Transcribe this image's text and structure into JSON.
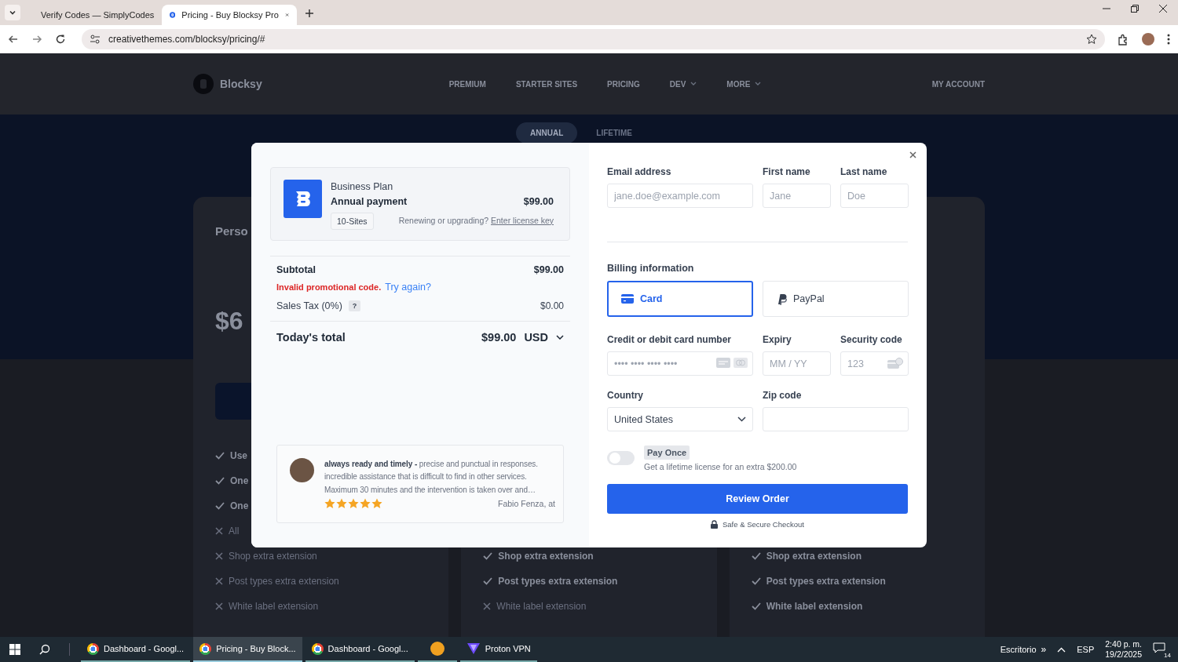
{
  "browser": {
    "tabs": [
      {
        "title": "Verify Codes — SimplyCodes",
        "kind": "verify",
        "selected": false
      },
      {
        "title": "Pricing - Buy Blocksy Pro",
        "kind": "blocksy",
        "selected": true
      }
    ],
    "url": "creativethemes.com/blocksy/pricing/#"
  },
  "site": {
    "logo": "Blocksy",
    "nav": [
      {
        "label": "PREMIUM",
        "dropdown": false
      },
      {
        "label": "STARTER SITES",
        "dropdown": false
      },
      {
        "label": "PRICING",
        "dropdown": false
      },
      {
        "label": "DEV",
        "dropdown": true
      },
      {
        "label": "MORE",
        "dropdown": true
      }
    ],
    "account": "MY ACCOUNT",
    "billing_toggle": [
      {
        "label": "ANNUAL",
        "selected": true
      },
      {
        "label": "LIFETIME",
        "selected": false
      }
    ],
    "plans": [
      {
        "name": "Perso",
        "price": "$6",
        "features": [
          {
            "label": "Use",
            "included": true
          },
          {
            "label": "One",
            "included": true
          },
          {
            "label": "One",
            "included": true
          },
          {
            "label": "All",
            "included": false
          },
          {
            "label": "Shop extra extension",
            "included": false
          },
          {
            "label": "Post types extra extension",
            "included": false
          },
          {
            "label": "White label extension",
            "included": false
          }
        ]
      },
      {
        "features": [
          {
            "label": "Shop extra extension",
            "included": true
          },
          {
            "label": "Post types extra extension",
            "included": true
          },
          {
            "label": "White label extension",
            "included": false
          }
        ]
      },
      {
        "features": [
          {
            "label": "Shop extra extension",
            "included": true
          },
          {
            "label": "Post types extra extension",
            "included": true
          },
          {
            "label": "White label extension",
            "included": true
          }
        ]
      }
    ]
  },
  "checkout": {
    "order": {
      "plan": "Business Plan",
      "billing": "Annual payment",
      "price": "$99.00",
      "sites": "10-Sites",
      "renew_prompt": "Renewing or upgrading?",
      "renew_link": "Enter license key"
    },
    "summary": {
      "subtotal_label": "Subtotal",
      "subtotal": "$99.00",
      "promo_error": "Invalid promotional code.",
      "promo_retry": "Try again?",
      "tax_label": "Sales Tax (0%)",
      "tax_help": "?",
      "tax": "$0.00",
      "total_label": "Today's total",
      "total": "$99.00",
      "currency": "USD"
    },
    "testimonial": {
      "text": "**always ready and timely -** precise and punctual in responses. incredible assistance that is difficult to find in other services. Maximum 30 minutes and the intervention is taken over and…",
      "stars": 5,
      "author": "Fabio Fenza, at"
    },
    "contact": [
      {
        "label": "Email address",
        "placeholder": "jane.doe@example.com"
      },
      {
        "label": "First name",
        "placeholder": "Jane"
      },
      {
        "label": "Last name",
        "placeholder": "Doe"
      }
    ],
    "billing_title": "Billing information",
    "methods": [
      {
        "label": "Card",
        "kind": "card",
        "selected": true
      },
      {
        "label": "PayPal",
        "kind": "paypal",
        "selected": false
      }
    ],
    "card_fields": [
      {
        "label": "Credit or debit card number",
        "placeholder": "•••• •••• •••• ••••",
        "kind": "number"
      },
      {
        "label": "Expiry",
        "placeholder": "MM / YY",
        "kind": "expiry"
      },
      {
        "label": "Security code",
        "placeholder": "123",
        "kind": "cvc"
      }
    ],
    "country": {
      "label": "Country",
      "value": "United States"
    },
    "zip": {
      "label": "Zip code"
    },
    "pay_once": {
      "on": false,
      "badge": "Pay Once",
      "description": "Get a lifetime license for an extra $200.00"
    },
    "submit": "Review Order",
    "secure_note": "Safe & Secure Checkout"
  },
  "taskbar": {
    "apps": [
      {
        "label": "Dashboard - Googl...",
        "kind": "chrome",
        "selected": false
      },
      {
        "label": "Pricing - Buy Block...",
        "kind": "chrome",
        "selected": true
      },
      {
        "label": "Dashboard - Googl...",
        "kind": "chrome",
        "selected": false
      },
      {
        "kind": "fox",
        "selected": false
      },
      {
        "label": "Proton VPN",
        "kind": "vpn",
        "selected": false
      }
    ],
    "desktop": "Escritorio",
    "overflow": "»",
    "language": "ESP",
    "time": "2:40 p. m.",
    "date": "19/2/2025",
    "notifications": "14"
  }
}
